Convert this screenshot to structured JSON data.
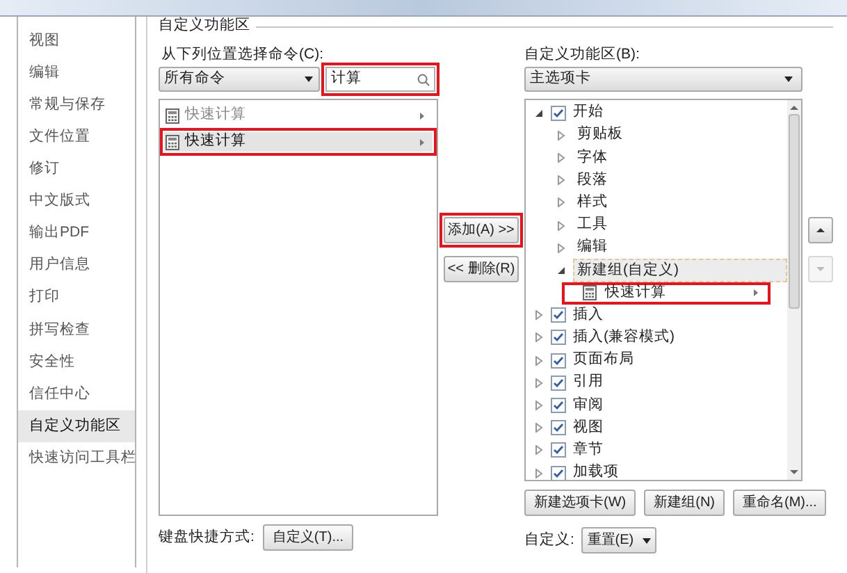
{
  "sidebar": {
    "items": [
      {
        "label": "视图",
        "selected": false
      },
      {
        "label": "编辑",
        "selected": false
      },
      {
        "label": "常规与保存",
        "selected": false
      },
      {
        "label": "文件位置",
        "selected": false
      },
      {
        "label": "修订",
        "selected": false
      },
      {
        "label": "中文版式",
        "selected": false
      },
      {
        "label": "输出PDF",
        "selected": false
      },
      {
        "label": "用户信息",
        "selected": false
      },
      {
        "label": "打印",
        "selected": false
      },
      {
        "label": "拼写检查",
        "selected": false
      },
      {
        "label": "安全性",
        "selected": false
      },
      {
        "label": "信任中心",
        "selected": false
      },
      {
        "label": "自定义功能区",
        "selected": true
      },
      {
        "label": "快速访问工具栏",
        "selected": false
      }
    ]
  },
  "section_title": "自定义功能区",
  "commands_panel": {
    "label": "从下列位置选择命令(C):",
    "source_dropdown": {
      "value": "所有命令"
    },
    "search": {
      "value": "计算",
      "highlighted": true
    },
    "items": [
      {
        "label": "快速计算",
        "selected": false
      },
      {
        "label": "快速计算",
        "selected": true,
        "highlighted": true
      }
    ]
  },
  "add_button": {
    "label": "添加(A) >>",
    "highlighted": true
  },
  "remove_button": {
    "label": "<< 删除(R)"
  },
  "ribbon_panel": {
    "label": "自定义功能区(B):",
    "dropdown": {
      "value": "主选项卡"
    },
    "tree": [
      {
        "kind": "tab",
        "label": "开始",
        "checked": true,
        "expanded": true,
        "children": [
          {
            "kind": "group",
            "label": "剪贴板",
            "expanded": false,
            "selected": false
          },
          {
            "kind": "group",
            "label": "字体",
            "expanded": false,
            "selected": false
          },
          {
            "kind": "group",
            "label": "段落",
            "expanded": false,
            "selected": false
          },
          {
            "kind": "group",
            "label": "样式",
            "expanded": false,
            "selected": false
          },
          {
            "kind": "group",
            "label": "工具",
            "expanded": false,
            "selected": false
          },
          {
            "kind": "group",
            "label": "编辑",
            "expanded": false,
            "selected": false
          },
          {
            "kind": "group",
            "label": "新建组(自定义)",
            "expanded": true,
            "selected": true,
            "children": [
              {
                "kind": "command",
                "label": "快速计算",
                "highlighted": true
              }
            ]
          }
        ]
      },
      {
        "kind": "tab",
        "label": "插入",
        "checked": true,
        "expanded": false
      },
      {
        "kind": "tab",
        "label": "插入(兼容模式)",
        "checked": true,
        "expanded": false
      },
      {
        "kind": "tab",
        "label": "页面布局",
        "checked": true,
        "expanded": false
      },
      {
        "kind": "tab",
        "label": "引用",
        "checked": true,
        "expanded": false
      },
      {
        "kind": "tab",
        "label": "审阅",
        "checked": true,
        "expanded": false
      },
      {
        "kind": "tab",
        "label": "视图",
        "checked": true,
        "expanded": false
      },
      {
        "kind": "tab",
        "label": "章节",
        "checked": true,
        "expanded": false
      },
      {
        "kind": "tab",
        "label": "加载项",
        "checked": true,
        "expanded": false
      }
    ],
    "move_up": {
      "disabled": false
    },
    "move_down": {
      "disabled": true
    },
    "buttons": [
      "新建选项卡(W)",
      "新建组(N)",
      "重命名(M)..."
    ]
  },
  "keyboard_shortcuts": {
    "label": "键盘快捷方式:",
    "button": "自定义(T)..."
  },
  "customize": {
    "label": "自定义:",
    "button": "重置(E)"
  }
}
